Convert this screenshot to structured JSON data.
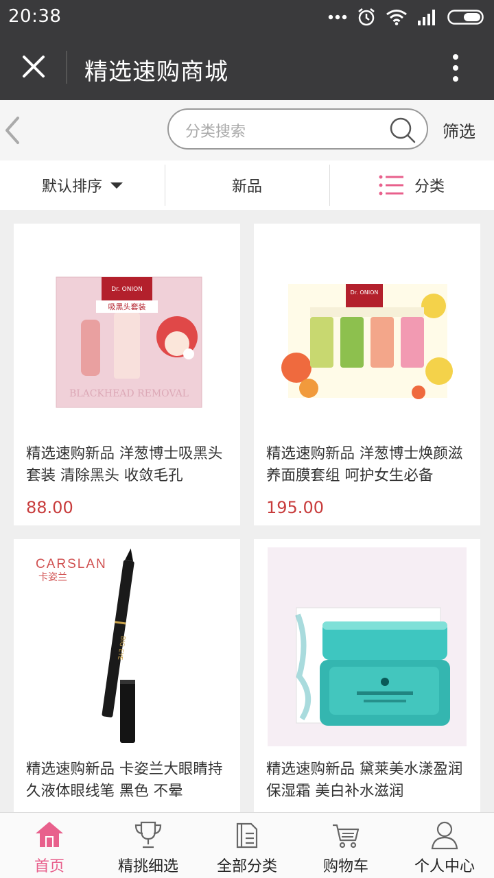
{
  "status_bar": {
    "time": "20:38"
  },
  "title_bar": {
    "title": "精选速购商城"
  },
  "search": {
    "placeholder": "分类搜索",
    "filter_label": "筛选"
  },
  "tabs": [
    {
      "label": "默认排序"
    },
    {
      "label": "新品"
    },
    {
      "label": "分类"
    }
  ],
  "products": [
    {
      "name": "精选速购新品 洋葱博士吸黑头套装 清除黑头 收敛毛孔",
      "price": "88.00",
      "image": "blackhead-kit-image",
      "box_brand": "Dr. ONION",
      "box_title": "吸黑头套装",
      "box_caption": "BLACKHEAD REMOVAL"
    },
    {
      "name": "精选速购新品 洋葱博士焕颜滋养面膜套组 呵护女生必备",
      "price": "195.00",
      "image": "mask-set-image",
      "box_brand": "Dr. ONION"
    },
    {
      "name": "精选速购新品 卡姿兰大眼睛持久液体眼线笔 黑色 不晕",
      "price": "",
      "image": "eyeliner-image",
      "brand_logo": "CARSLAN",
      "brand_logo_cn": "卡姿兰",
      "pen_text": "BIG EYE"
    },
    {
      "name": "精选速购新品 黛莱美水漾盈润保湿霜 美白补水滋润",
      "price": "",
      "image": "cream-jar-image"
    }
  ],
  "bottom_nav": [
    {
      "label": "首页",
      "icon": "home-icon",
      "active": true
    },
    {
      "label": "精挑细选",
      "icon": "trophy-icon",
      "active": false
    },
    {
      "label": "全部分类",
      "icon": "category-icon",
      "active": false
    },
    {
      "label": "购物车",
      "icon": "cart-icon",
      "active": false
    },
    {
      "label": "个人中心",
      "icon": "user-icon",
      "active": false
    }
  ],
  "colors": {
    "accent": "#e8608c",
    "price": "#c83c3c",
    "header": "#3a3a3c"
  }
}
